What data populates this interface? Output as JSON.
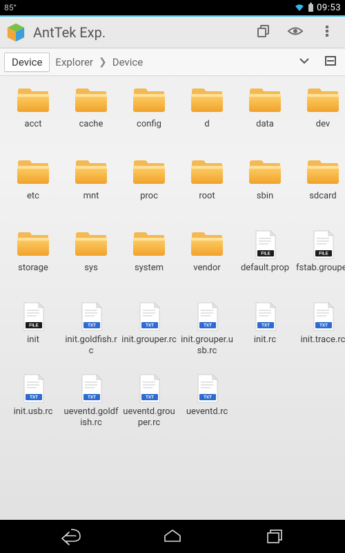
{
  "statusbar": {
    "temp": "85°",
    "time": "09:53"
  },
  "app": {
    "title": "AntTek Exp."
  },
  "path": {
    "tab": "Device",
    "crumb1": "Explorer",
    "crumb2": "Device"
  },
  "items": [
    {
      "name": "acct",
      "type": "folder"
    },
    {
      "name": "cache",
      "type": "folder"
    },
    {
      "name": "config",
      "type": "folder"
    },
    {
      "name": "d",
      "type": "folder"
    },
    {
      "name": "data",
      "type": "folder"
    },
    {
      "name": "dev",
      "type": "folder"
    },
    {
      "name": "etc",
      "type": "folder"
    },
    {
      "name": "mnt",
      "type": "folder"
    },
    {
      "name": "proc",
      "type": "folder"
    },
    {
      "name": "root",
      "type": "folder"
    },
    {
      "name": "sbin",
      "type": "folder"
    },
    {
      "name": "sdcard",
      "type": "folder"
    },
    {
      "name": "storage",
      "type": "folder"
    },
    {
      "name": "sys",
      "type": "folder"
    },
    {
      "name": "system",
      "type": "folder"
    },
    {
      "name": "vendor",
      "type": "folder"
    },
    {
      "name": "default.prop",
      "type": "file"
    },
    {
      "name": "fstab.grouper",
      "type": "file"
    },
    {
      "name": "init",
      "type": "file"
    },
    {
      "name": "init.goldfish.rc",
      "type": "txt"
    },
    {
      "name": "init.grouper.rc",
      "type": "txt"
    },
    {
      "name": "init.grouper.usb.rc",
      "type": "txt"
    },
    {
      "name": "init.rc",
      "type": "txt"
    },
    {
      "name": "init.trace.rc",
      "type": "txt"
    },
    {
      "name": "init.usb.rc",
      "type": "txt"
    },
    {
      "name": "ueventd.goldfish.rc",
      "type": "txt"
    },
    {
      "name": "ueventd.grouper.rc",
      "type": "txt"
    },
    {
      "name": "ueventd.rc",
      "type": "txt"
    }
  ],
  "icon_labels": {
    "file": "FILE",
    "txt": "TXT"
  }
}
